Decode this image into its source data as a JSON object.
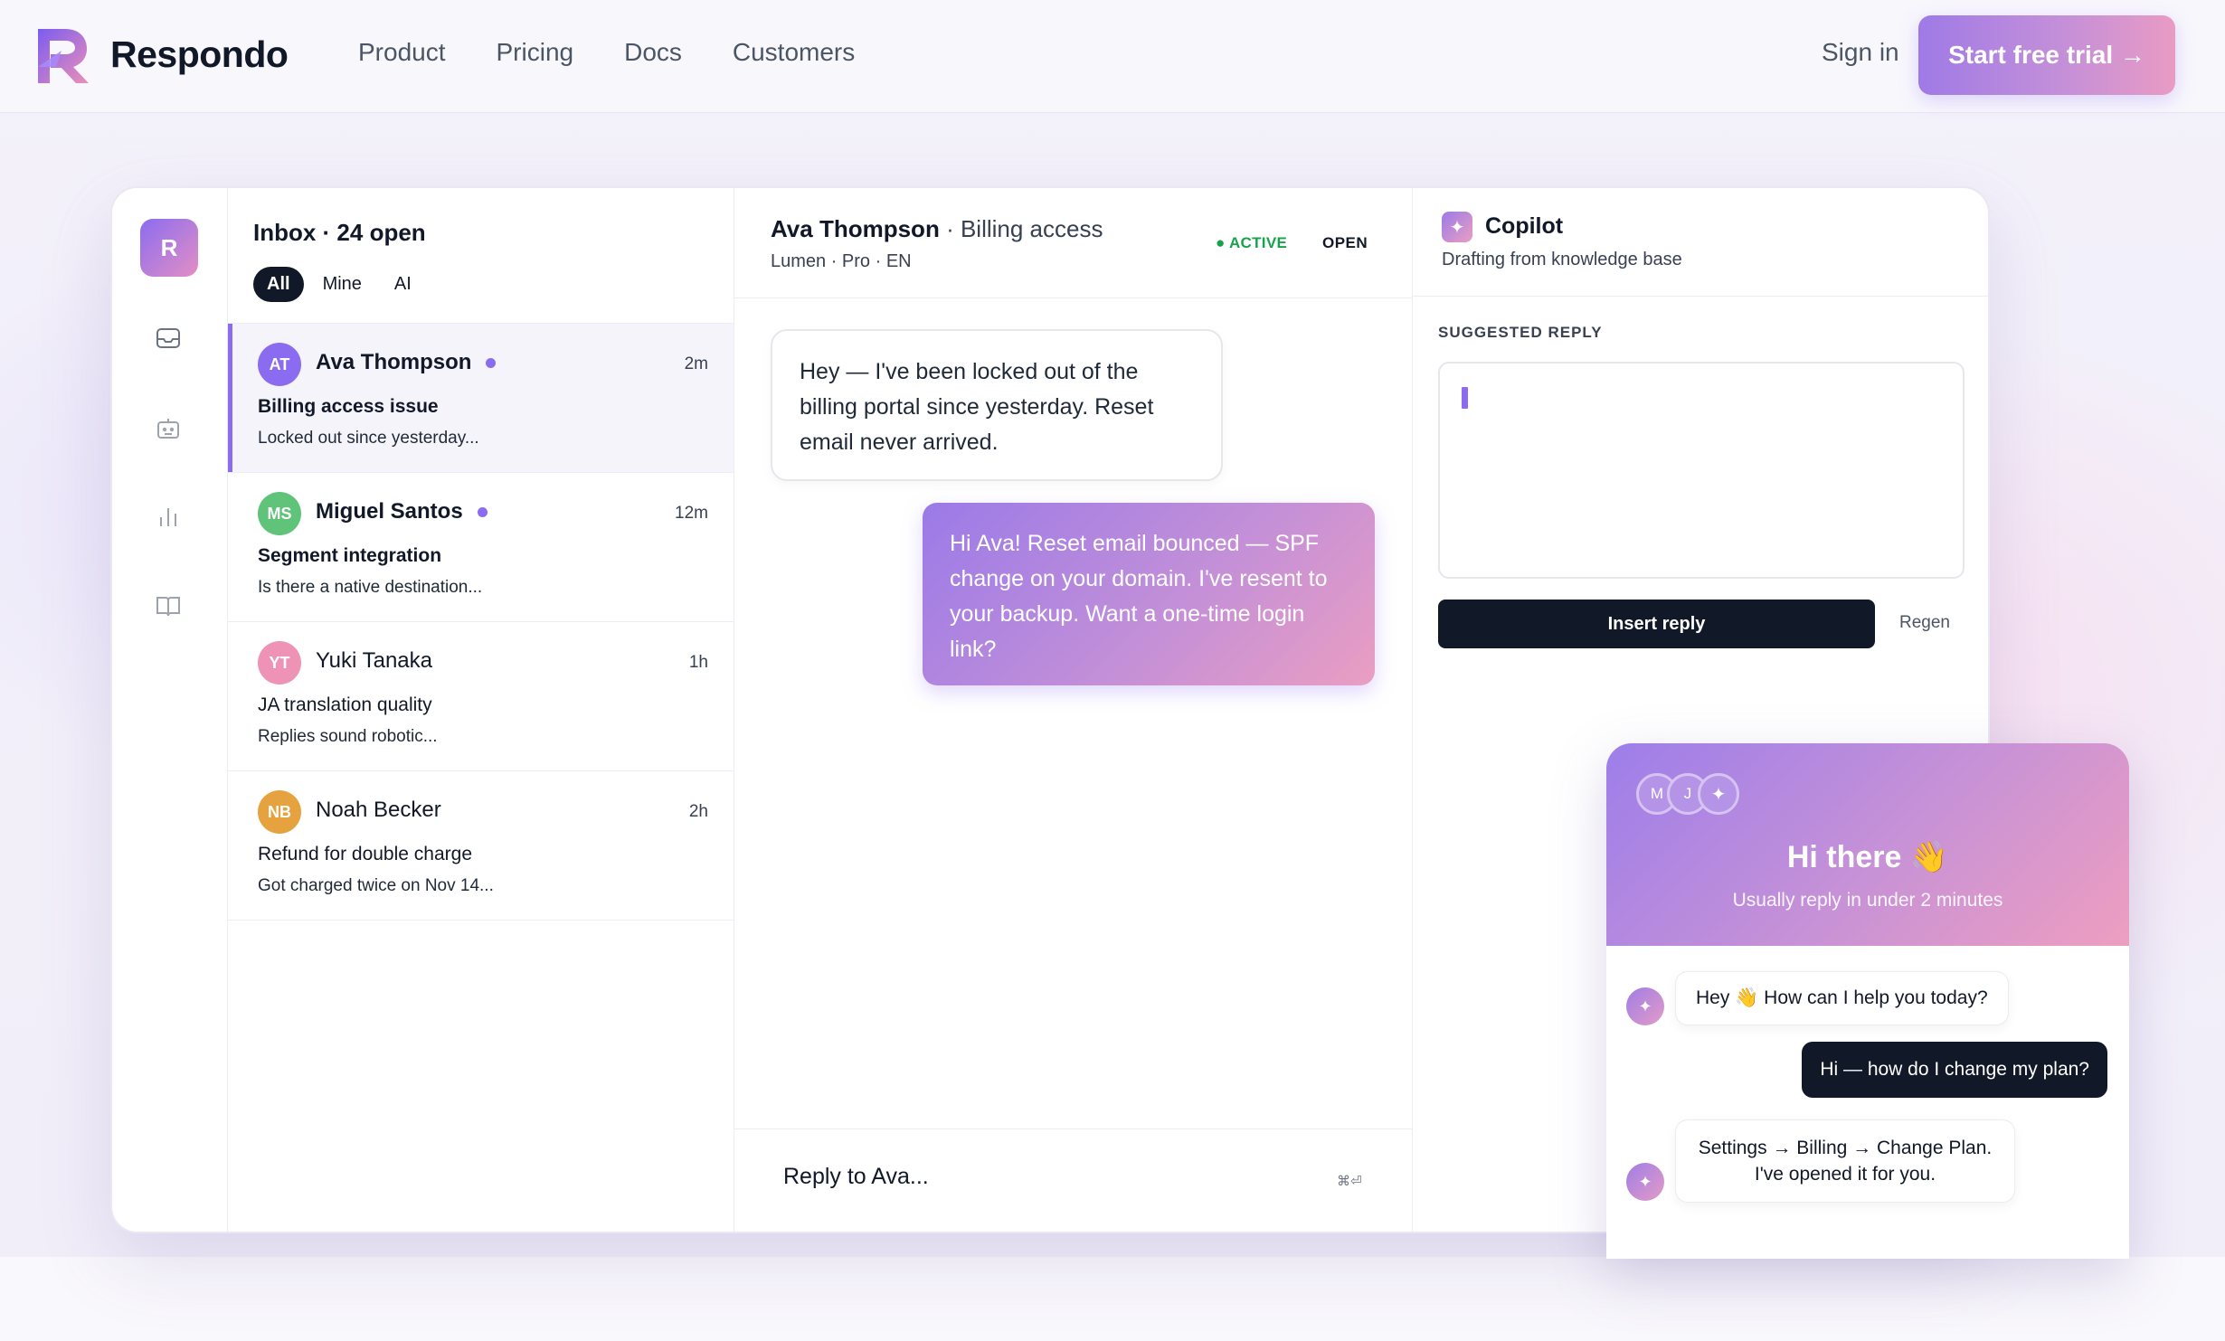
{
  "nav": {
    "brand": "Respondo",
    "links": [
      "Product",
      "Pricing",
      "Docs",
      "Customers"
    ],
    "signin": "Sign in",
    "cta": "Start free trial →"
  },
  "colors": {
    "accent": "#8b6cf0",
    "accent_pink": "#ea9ec2",
    "dark": "#111827",
    "active_status": "#16a34a"
  },
  "rail": {
    "logo_letter": "R",
    "icons": [
      "inbox-icon",
      "bot-icon",
      "analytics-icon",
      "knowledge-book-icon"
    ]
  },
  "inbox": {
    "title": "Inbox · 24 open",
    "filters": [
      "All",
      "Mine",
      "AI"
    ],
    "active_filter": "All",
    "conversations": [
      {
        "initials": "AT",
        "name": "Ava Thompson",
        "time": "2m",
        "subject": "Billing access issue",
        "preview": "Locked out since yesterday...",
        "unread": true,
        "selected": true,
        "color": "#8b6cf0"
      },
      {
        "initials": "MS",
        "name": "Miguel Santos",
        "time": "12m",
        "subject": "Segment integration",
        "preview": "Is there a native destination...",
        "unread": true,
        "selected": false,
        "color": "#5fc47a"
      },
      {
        "initials": "YT",
        "name": "Yuki Tanaka",
        "time": "1h",
        "subject": "JA translation quality",
        "preview": "Replies sound robotic...",
        "unread": false,
        "selected": false,
        "color": "#ef93b6"
      },
      {
        "initials": "NB",
        "name": "Noah Becker",
        "time": "2h",
        "subject": "Refund for double charge",
        "preview": "Got charged twice on Nov 14...",
        "unread": false,
        "selected": false,
        "color": "#e6a23f"
      }
    ]
  },
  "chat": {
    "customer": "Ava Thompson",
    "topic": "· Billing access",
    "meta": "Lumen · Pro · EN",
    "status": "● ACTIVE",
    "state": "OPEN",
    "messages": {
      "incoming": "Hey — I've been locked out of the billing portal since yesterday. Reset email never arrived.",
      "outgoing": "Hi Ava! Reset email bounced — SPF change on your domain. I've resent to your backup. Want a one-time login link?"
    },
    "composer_placeholder": "Reply to Ava...",
    "shortcut": "⌘⏎"
  },
  "copilot": {
    "icon": "✦",
    "title": "Copilot",
    "subtitle": "Drafting from knowledge base",
    "suggested_label": "SUGGESTED REPLY",
    "insert_label": "Insert reply",
    "regen_label": "Regen"
  },
  "widget": {
    "avatars": [
      "M",
      "J",
      "✦"
    ],
    "title": "Hi there 👋",
    "subtitle": "Usually reply in under 2 minutes",
    "bot_icon": "✦",
    "msg1": "Hey 👋 How can I help you today?",
    "msg2": "Hi — how do I change my plan?",
    "msg3_line1": "Settings → Billing → Change Plan.",
    "msg3_line2": "I've opened it for you."
  }
}
